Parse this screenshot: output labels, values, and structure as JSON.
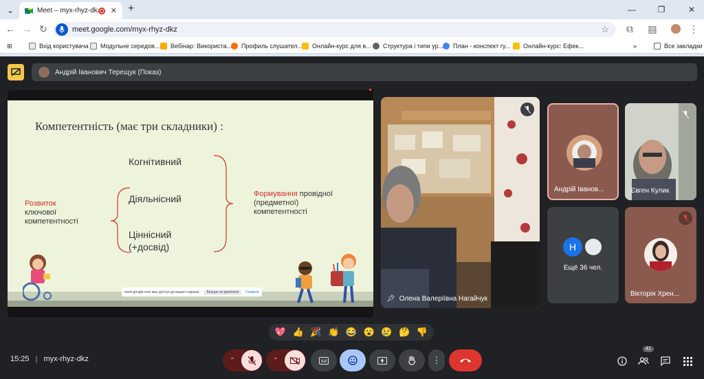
{
  "browser": {
    "tab_title": "Meet – myx-rhyz-dkz",
    "new_tab": "+",
    "url": "meet.google.com/myx-rhyz-dkz",
    "bookmarks": [
      {
        "label": "Вхід користувача",
        "color": "#5f6368"
      },
      {
        "label": "Модульне середов...",
        "color": "#5f6368"
      },
      {
        "label": "Вебінар: Використа...",
        "color": "#f9ab00"
      },
      {
        "label": "Профиль слушател...",
        "color": "#ff6d00"
      },
      {
        "label": "Онлайн-курс для в...",
        "color": "#fbbc04"
      },
      {
        "label": "Структура і типи ур...",
        "color": "#5f6368"
      },
      {
        "label": "План - конспект гу...",
        "color": "#4285f4"
      },
      {
        "label": "Онлайн-курс: Ефек...",
        "color": "#fbbc04"
      }
    ],
    "bookmarks_more": "»",
    "all_bookmarks": "Все закладки"
  },
  "meet": {
    "presenter_label": "Андрій Іванович Терещук (Показ)",
    "slide": {
      "heading": "Компетентність (має три складники) :",
      "item1": "Когнітивний",
      "item2": "Діяльнісний",
      "item3a": "Ціннісний",
      "item3b": "(+досвід)",
      "left_red": "Розвиток",
      "left_1": "ключової",
      "left_2": "компетентності",
      "right_red": "Формування",
      "right_1": " провідної",
      "right_2": "(предметної)",
      "right_3": "компетентності"
    },
    "share_notice": "meet.google.com має доступ до вашого екрана.",
    "share_stop": "Більше не допитися",
    "share_hide": "Сховати",
    "tiles": {
      "main_name": "Олена Валеріївна Нагайчук",
      "t1": "Андрій Іванов...",
      "t2": "Євген Кулик",
      "more_letter": "H",
      "more": "Ещё 36 чел.",
      "t4": "Вікторія Хрен..."
    },
    "reactions": [
      "💖",
      "👍",
      "🎉",
      "👏",
      "😂",
      "😮",
      "😢",
      "🤔",
      "👎"
    ],
    "time": "15:25",
    "meeting_code": "myx-rhyz-dkz",
    "participants_count": "41",
    "colors": {
      "accent_red": "#ea4335",
      "presenter": "#f2c94c",
      "selected": "#a8c7fa"
    }
  }
}
